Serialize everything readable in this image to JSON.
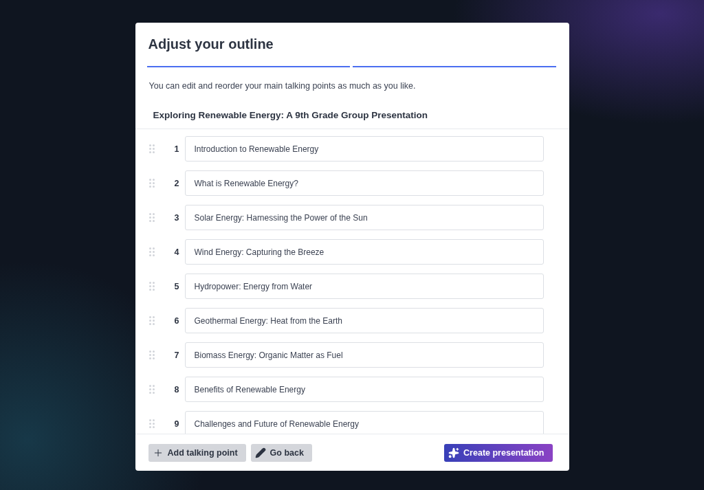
{
  "dialog": {
    "title": "Adjust your outline",
    "steps": [
      {
        "complete": true
      },
      {
        "complete": true
      }
    ],
    "description": "You can edit and reorder your main talking points as much as you like.",
    "outline_title": "Exploring Renewable Energy: A 9th Grade Group Presentation"
  },
  "talking_points": [
    {
      "number": "1",
      "value": "Introduction to Renewable Energy"
    },
    {
      "number": "2",
      "value": "What is Renewable Energy?"
    },
    {
      "number": "3",
      "value": "Solar Energy: Harnessing the Power of the Sun"
    },
    {
      "number": "4",
      "value": "Wind Energy: Capturing the Breeze"
    },
    {
      "number": "5",
      "value": "Hydropower: Energy from Water"
    },
    {
      "number": "6",
      "value": "Geothermal Energy: Heat from the Earth"
    },
    {
      "number": "7",
      "value": "Biomass Energy: Organic Matter as Fuel"
    },
    {
      "number": "8",
      "value": "Benefits of Renewable Energy"
    },
    {
      "number": "9",
      "value": "Challenges and Future of Renewable Energy"
    }
  ],
  "footer": {
    "buttons": [
      {
        "kind": "add",
        "label": "Add talking point"
      },
      {
        "kind": "back",
        "label": "Go back"
      },
      {
        "kind": "create",
        "label": "Create presentation"
      }
    ]
  }
}
